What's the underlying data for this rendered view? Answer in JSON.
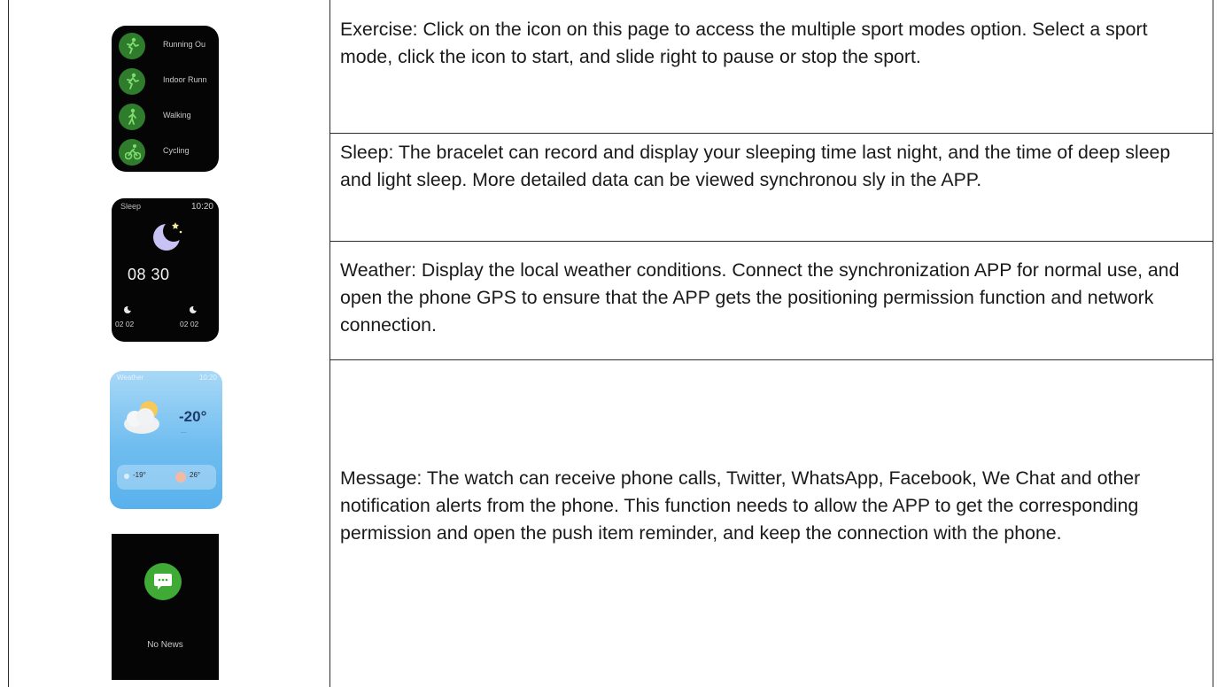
{
  "rows": {
    "exercise": {
      "text": "Exercise: Click on the icon on this page to access the multiple sport modes option. Select a sport mode, click the icon to start, and slide right to pause or stop the sport."
    },
    "sleep": {
      "text": "Sleep: The bracelet can record and display your sleeping time last night, and the time of deep sleep and light sleep. More detailed data can be viewed synchronou sly in the APP."
    },
    "weather": {
      "text": "Weather: Display the local weather conditions. Connect the synchronization APP for normal use, and open the phone GPS to ensure that the APP gets the positioning permission function and network connection."
    },
    "message": {
      "text": "Message: The watch can receive phone calls, Twitter, WhatsApp, Facebook, We Chat and other notification alerts from the phone. This function needs to allow the APP to get the corresponding permission and open the push item reminder, and keep the connection with the phone."
    }
  },
  "screens": {
    "exercise": {
      "items": [
        "Running Ou",
        "Indoor Runn",
        "Walking",
        "Cycling"
      ],
      "icon_color": "#2f7d2c"
    },
    "sleep": {
      "title": "Sleep",
      "time": "10:20",
      "total": "08 30",
      "left_value": "02 02",
      "right_value": "02 02"
    },
    "weather": {
      "title": "Weather",
      "time": "10:20",
      "temp": "-20°",
      "min": "-19°",
      "max": "26°"
    },
    "message": {
      "status": "No News",
      "icon_color": "#3fab36"
    }
  }
}
